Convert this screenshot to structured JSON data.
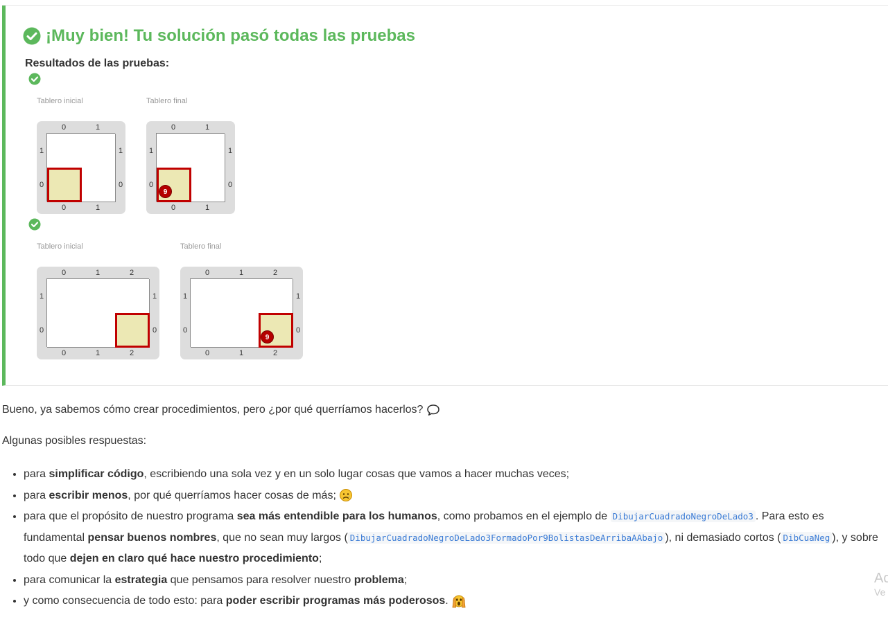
{
  "result": {
    "title": "¡Muy bien! Tu solución pasó todas las pruebas",
    "tests_heading": "Resultados de las pruebas:",
    "tests": [
      {
        "initial_caption": "Tablero inicial",
        "final_caption": "Tablero final",
        "columns": [
          "0",
          "1"
        ],
        "rows": [
          "1",
          "0"
        ],
        "ball_count": "9"
      },
      {
        "initial_caption": "Tablero inicial",
        "final_caption": "Tablero final",
        "columns": [
          "0",
          "1",
          "2"
        ],
        "rows": [
          "1",
          "0"
        ],
        "ball_count": "9"
      }
    ]
  },
  "content": {
    "intro": "Bueno, ya sabemos cómo crear procedimientos, pero ¿por qué querríamos hacerlos?",
    "answers_intro": "Algunas posibles respuestas:",
    "items": [
      {
        "p1": "para ",
        "b1": "simplificar código",
        "p2": ", escribiendo una sola vez y en un solo lugar cosas que vamos a hacer muchas veces;"
      },
      {
        "p1": "para ",
        "b1": "escribir menos",
        "p2": ", por qué querríamos hacer cosas de más;"
      },
      {
        "p1": "para que el propósito de nuestro programa ",
        "b1": "sea más entendible para los humanos",
        "p2": ", como probamos en el ejemplo de ",
        "c1": "DibujarCuadradoNegroDeLado3",
        "p3": ". Para esto es fundamental ",
        "b2": "pensar buenos nombres",
        "p4": ", que no sean muy largos (",
        "c2": "DibujarCuadradoNegroDeLado3FormadoPor9BolistasDeArribaAAbajo",
        "p5": "), ni demasiado cortos (",
        "c3": "DibCuaNeg",
        "p6": "), y sobre todo que ",
        "b3": "dejen en claro qué hace nuestro procedimiento",
        "p7": ";"
      },
      {
        "p1": "para comunicar la ",
        "b1": "estrategia",
        "p2": " que pensamos para resolver nuestro ",
        "b2": "problema",
        "p3": ";"
      },
      {
        "p1": "y como consecuencia de todo esto: para ",
        "b1": "poder escribir programas más poderosos",
        "p2": "."
      }
    ]
  },
  "watermark": {
    "line1": "Ac",
    "line2": "Ve"
  },
  "colors": {
    "success": "#5cb85c",
    "cell_selected": "#ece8b4",
    "cell_border_selected": "#c00000",
    "ball": "#b50000",
    "code": "#3a7bd5"
  }
}
